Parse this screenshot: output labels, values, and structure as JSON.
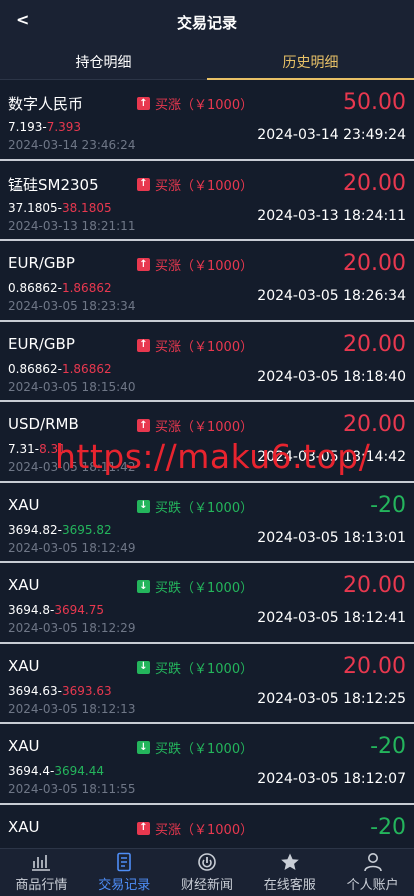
{
  "header": {
    "back": "<",
    "title": "交易记录"
  },
  "tabs": [
    {
      "label": "持仓明细",
      "active": false
    },
    {
      "label": "历史明细",
      "active": true
    }
  ],
  "records": [
    {
      "name": "数字人民币",
      "dir": "up",
      "dir_label": "买涨（￥1000）",
      "profit": "50.00",
      "profit_color": "red",
      "open": "7.193",
      "close": "7.393",
      "close_color": "red",
      "open_time": "2024-03-14 23:46:24",
      "close_time": "2024-03-14 23:49:24"
    },
    {
      "name": "锰硅SM2305",
      "dir": "up",
      "dir_label": "买涨（￥1000）",
      "profit": "20.00",
      "profit_color": "red",
      "open": "37.1805",
      "close": "38.1805",
      "close_color": "red",
      "open_time": "2024-03-13 18:21:11",
      "close_time": "2024-03-13 18:24:11"
    },
    {
      "name": "EUR/GBP",
      "dir": "up",
      "dir_label": "买涨（￥1000）",
      "profit": "20.00",
      "profit_color": "red",
      "open": "0.86862",
      "close": "1.86862",
      "close_color": "red",
      "open_time": "2024-03-05 18:23:34",
      "close_time": "2024-03-05 18:26:34"
    },
    {
      "name": "EUR/GBP",
      "dir": "up",
      "dir_label": "买涨（￥1000）",
      "profit": "20.00",
      "profit_color": "red",
      "open": "0.86862",
      "close": "1.86862",
      "close_color": "red",
      "open_time": "2024-03-05 18:15:40",
      "close_time": "2024-03-05 18:18:40"
    },
    {
      "name": "USD/RMB",
      "dir": "up",
      "dir_label": "买涨（￥1000）",
      "profit": "20.00",
      "profit_color": "red",
      "open": "7.31",
      "close": "8.31",
      "close_color": "red",
      "open_time": "2024-03-05 18:11:42",
      "close_time": "2024-03-05 18:14:42"
    },
    {
      "name": "XAU",
      "dir": "down",
      "dir_label": "买跌（￥1000）",
      "profit": "-20",
      "profit_color": "green",
      "open": "3694.82",
      "close": "3695.82",
      "close_color": "green",
      "open_time": "2024-03-05 18:12:49",
      "close_time": "2024-03-05 18:13:01"
    },
    {
      "name": "XAU",
      "dir": "down",
      "dir_label": "买跌（￥1000）",
      "profit": "20.00",
      "profit_color": "red",
      "open": "3694.8",
      "close": "3694.75",
      "close_color": "red",
      "open_time": "2024-03-05 18:12:29",
      "close_time": "2024-03-05 18:12:41"
    },
    {
      "name": "XAU",
      "dir": "down",
      "dir_label": "买跌（￥1000）",
      "profit": "20.00",
      "profit_color": "red",
      "open": "3694.63",
      "close": "3693.63",
      "close_color": "red",
      "open_time": "2024-03-05 18:12:13",
      "close_time": "2024-03-05 18:12:25"
    },
    {
      "name": "XAU",
      "dir": "down",
      "dir_label": "买跌（￥1000）",
      "profit": "-20",
      "profit_color": "green",
      "open": "3694.4",
      "close": "3694.44",
      "close_color": "green",
      "open_time": "2024-03-05 18:11:55",
      "close_time": "2024-03-05 18:12:07"
    },
    {
      "name": "XAU",
      "dir": "up",
      "dir_label": "买涨（￥1000）",
      "profit": "-20",
      "profit_color": "green",
      "open": "",
      "close": "",
      "close_color": "green",
      "open_time": "",
      "close_time": ""
    }
  ],
  "watermark": "https://maku6.top/",
  "nav": [
    {
      "label": "商品行情",
      "icon": "chart-icon",
      "active": false
    },
    {
      "label": "交易记录",
      "icon": "document-icon",
      "active": true
    },
    {
      "label": "财经新闻",
      "icon": "power-icon",
      "active": false
    },
    {
      "label": "在线客服",
      "icon": "star-icon",
      "active": false
    },
    {
      "label": "个人账户",
      "icon": "user-icon",
      "active": false
    }
  ]
}
